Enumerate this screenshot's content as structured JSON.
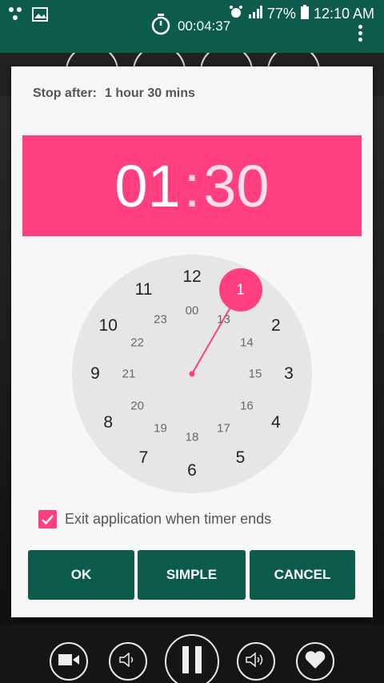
{
  "status_bar": {
    "battery": "77%",
    "time": "12:10 AM",
    "icons": [
      "water-drops-icon",
      "image-icon",
      "alarm-icon",
      "signal-icon",
      "battery-icon"
    ]
  },
  "app_bar": {
    "stopwatch_time": "00:04:37"
  },
  "dialog": {
    "stop_after_label": "Stop after:",
    "stop_after_value": "1 hour 30 mins",
    "time_hours": "01",
    "time_separator": ":",
    "time_minutes": "30",
    "clock": {
      "selected": "1",
      "outer_numbers": [
        "12",
        "1",
        "2",
        "3",
        "4",
        "5",
        "6",
        "7",
        "8",
        "9",
        "10",
        "11"
      ],
      "inner_numbers": [
        "00",
        "13",
        "14",
        "15",
        "16",
        "17",
        "18",
        "19",
        "20",
        "21",
        "22",
        "23"
      ]
    },
    "exit_checkbox_label": "Exit application when timer ends",
    "exit_checked": true,
    "buttons": {
      "ok": "OK",
      "simple": "SIMPLE",
      "cancel": "CANCEL"
    }
  },
  "colors": {
    "accent": "#ff3f7f",
    "primary": "#0d5b4c"
  }
}
